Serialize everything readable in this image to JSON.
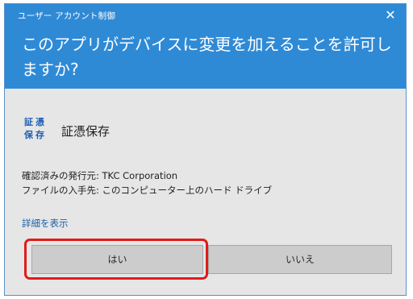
{
  "window": {
    "title": "ユーザー アカウント制御",
    "close_glyph": "✕"
  },
  "prompt": {
    "question": "このアプリがデバイスに変更を加えることを許可しますか?"
  },
  "app": {
    "icon_chars": [
      "証",
      "憑",
      "保",
      "存"
    ],
    "name": "証憑保存",
    "icon_color": "#1f5fb3"
  },
  "details": {
    "publisher_line": "確認済みの発行元: TKC Corporation",
    "origin_line": "ファイルの入手先: このコンピューター上のハード ドライブ"
  },
  "links": {
    "show_details": "詳細を表示"
  },
  "buttons": {
    "yes_label": "はい",
    "no_label": "いいえ"
  },
  "colors": {
    "header_bg": "#2f8ad6",
    "body_bg": "#e6e6e6",
    "highlight": "#e01b1b"
  }
}
